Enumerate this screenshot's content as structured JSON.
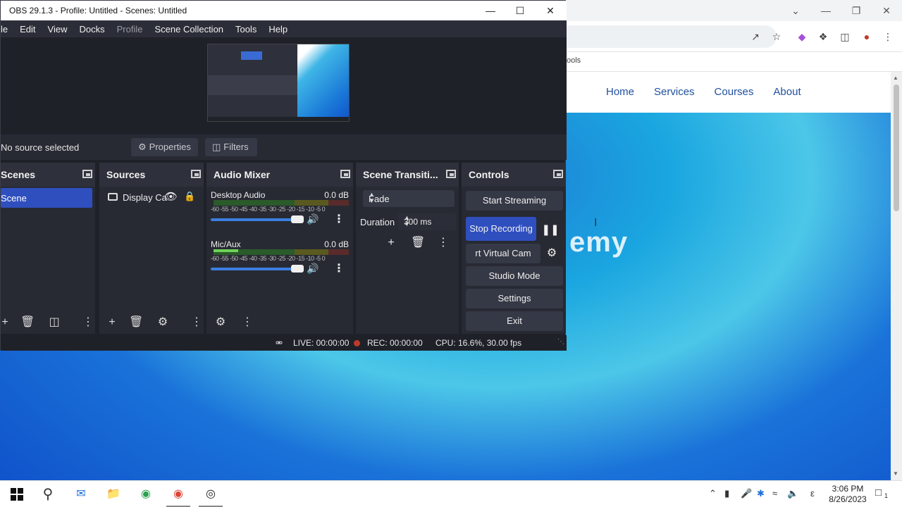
{
  "browser": {
    "bookmark_text": "ools",
    "nav": [
      "Home",
      "Services",
      "Courses",
      "About"
    ],
    "hero_text": "emy"
  },
  "obs": {
    "title": "OBS 29.1.3 - Profile: Untitled - Scenes: Untitled",
    "menu": [
      "le",
      "Edit",
      "View",
      "Docks",
      "Profile",
      "Scene Collection",
      "Tools",
      "Help"
    ],
    "no_source": "No source selected",
    "properties_label": "Properties",
    "filters_label": "Filters",
    "scenes": {
      "title": "Scenes",
      "items": [
        "Scene"
      ]
    },
    "sources": {
      "title": "Sources",
      "items": [
        "Display Ca"
      ]
    },
    "mixer": {
      "title": "Audio Mixer",
      "scale": "-60 -55 -50 -45 -40 -35 -30 -25 -20 -15 -10 -5 0",
      "channels": [
        {
          "name": "Desktop Audio",
          "db": "0.0 dB",
          "level": 0.0
        },
        {
          "name": "Mic/Aux",
          "db": "0.0 dB",
          "level": 0.18
        }
      ]
    },
    "transitions": {
      "title": "Scene Transiti...",
      "selected": "Fade",
      "duration_label": "Duration",
      "duration_value": "300 ms"
    },
    "controls": {
      "title": "Controls",
      "start_streaming": "Start Streaming",
      "stop_recording": "Stop Recording",
      "virtual_cam": "rt Virtual Cam",
      "studio_mode": "Studio Mode",
      "settings": "Settings",
      "exit": "Exit"
    },
    "status": {
      "live": "LIVE: 00:00:00",
      "rec": "REC: 00:00:00",
      "cpu": "CPU: 16.6%, 30.00 fps"
    }
  },
  "taskbar": {
    "time": "3:06 PM",
    "date": "8/26/2023",
    "lang": "ε",
    "notif_count": "1"
  }
}
